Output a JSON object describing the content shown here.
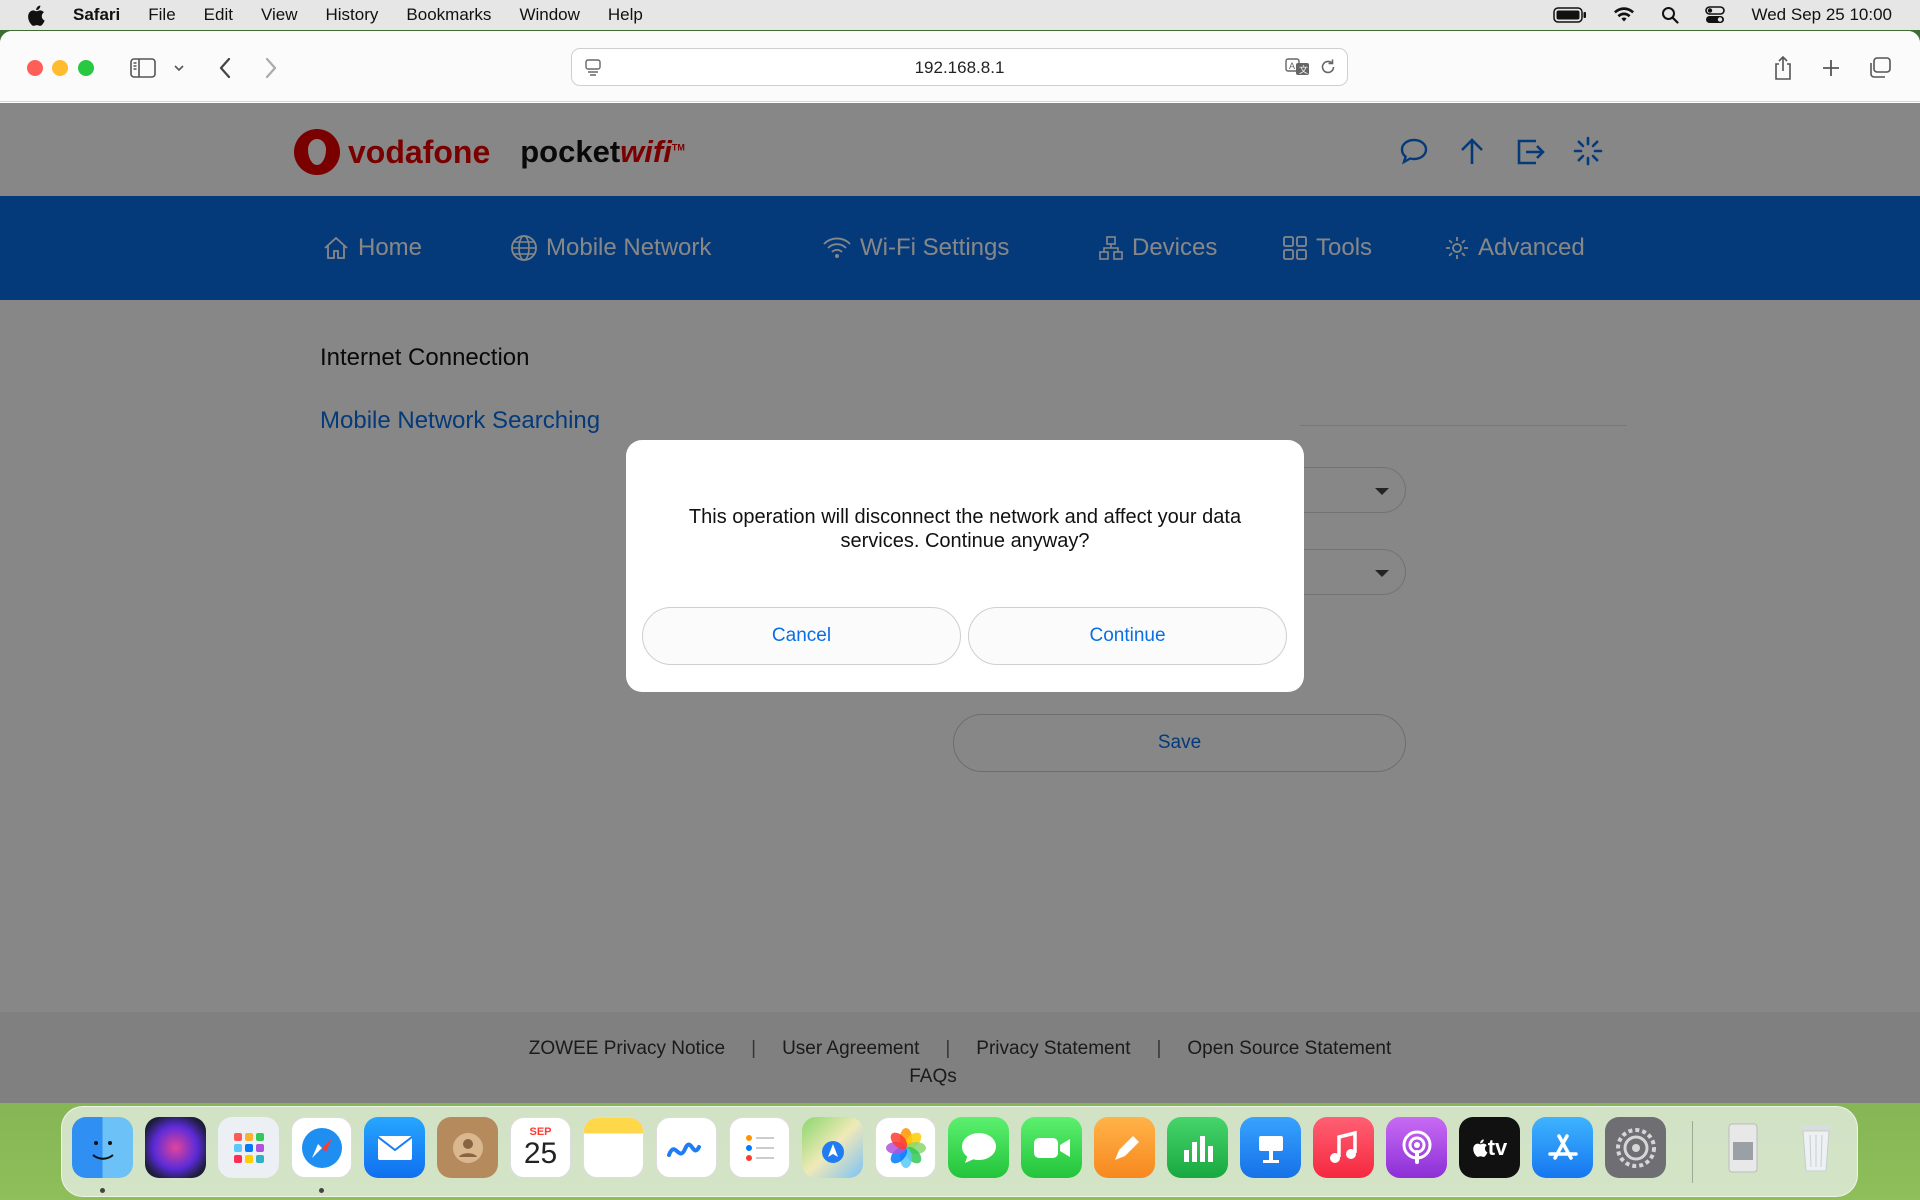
{
  "menubar": {
    "app_name": "Safari",
    "menus": [
      "File",
      "Edit",
      "View",
      "History",
      "Bookmarks",
      "Window",
      "Help"
    ],
    "clock": "Wed Sep 25  10:00"
  },
  "browser": {
    "url": "192.168.8.1"
  },
  "header": {
    "brand": "vodafone",
    "product_prefix": "pocket",
    "product_suffix": "wifi",
    "trademark": "TM"
  },
  "nav": {
    "items": [
      {
        "label": "Home",
        "icon": "home-icon"
      },
      {
        "label": "Mobile Network",
        "icon": "globe-icon"
      },
      {
        "label": "Wi-Fi Settings",
        "icon": "wifi-icon"
      },
      {
        "label": "Devices",
        "icon": "devices-icon"
      },
      {
        "label": "Tools",
        "icon": "tools-icon"
      },
      {
        "label": "Advanced",
        "icon": "gear-icon"
      }
    ]
  },
  "sidebar": {
    "items": [
      {
        "label": "Internet Connection"
      },
      {
        "label": "Mobile Network Searching"
      }
    ]
  },
  "main": {
    "save_label": "Save"
  },
  "footer": {
    "links": [
      "ZOWEE Privacy Notice",
      "User Agreement",
      "Privacy Statement",
      "Open Source Statement"
    ],
    "faq": "FAQs"
  },
  "dialog": {
    "message": "This operation will disconnect the network and affect your data services. Continue anyway?",
    "cancel_label": "Cancel",
    "continue_label": "Continue"
  },
  "dock": {
    "calendar_month": "SEP",
    "calendar_day": "25",
    "tv_label": "tv"
  },
  "colors": {
    "brand_red": "#e60000",
    "nav_blue": "#0a6fe6",
    "link_blue": "#0a6fe6"
  }
}
